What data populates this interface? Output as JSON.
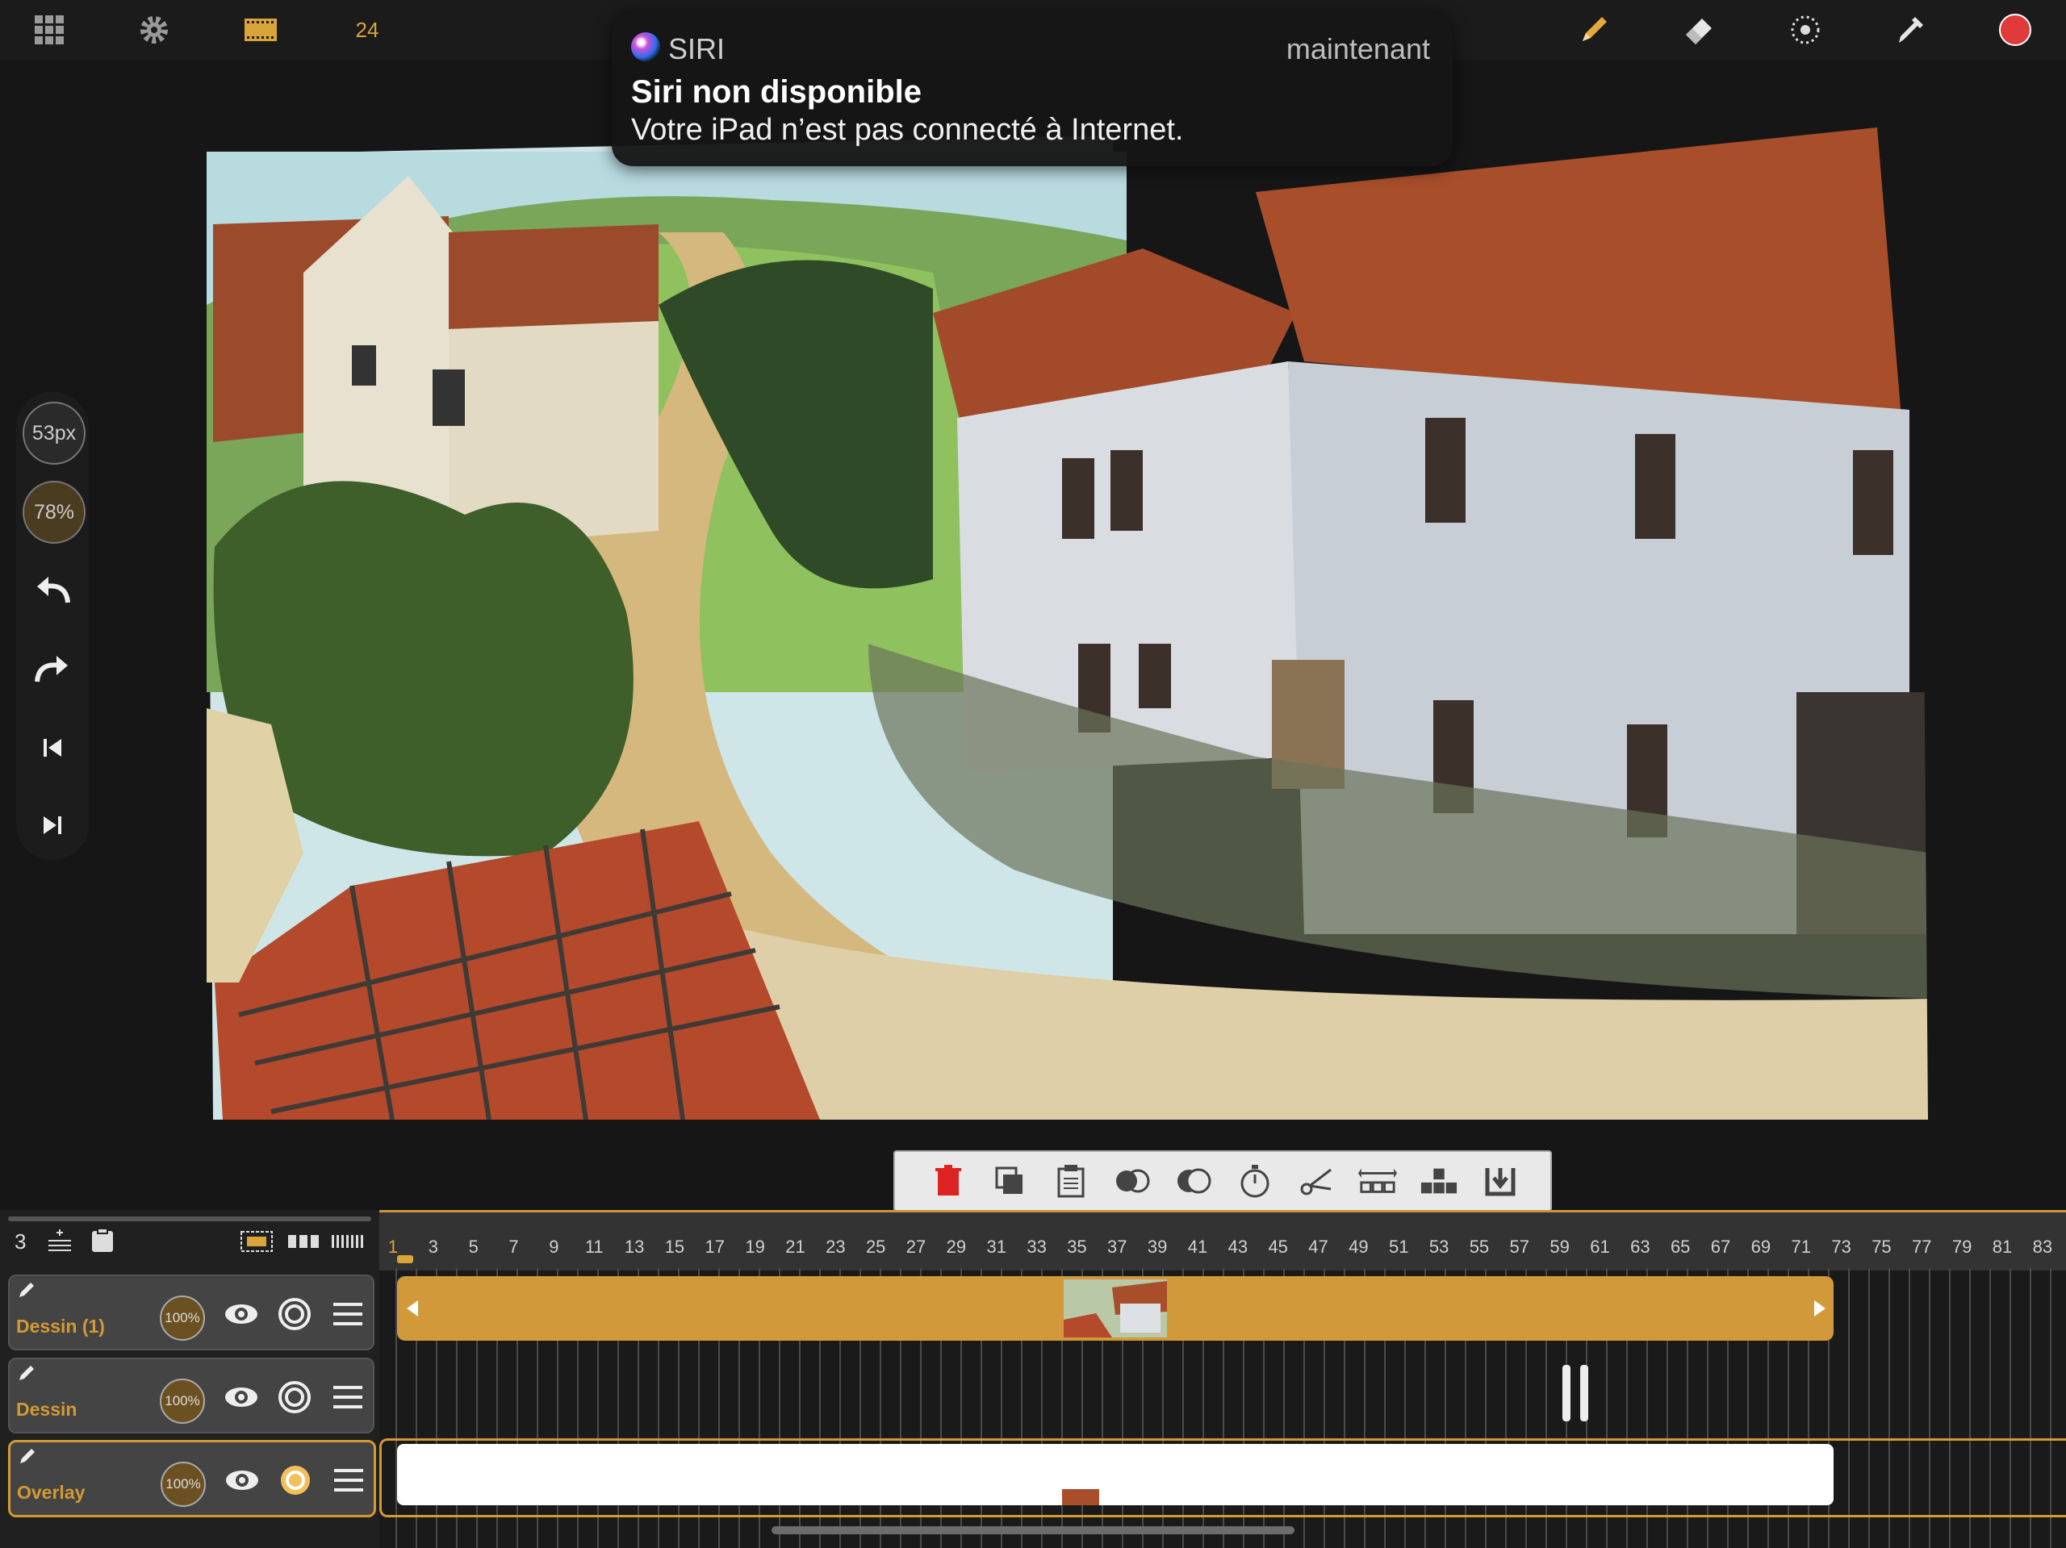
{
  "topbar": {
    "fps": "24",
    "left_icons": [
      "grid-icon",
      "gear-icon",
      "film-icon"
    ],
    "right_icons": [
      "pencil-icon",
      "eraser-icon",
      "smudge-icon",
      "eyedropper-icon",
      "color-swatch-icon"
    ],
    "record_color": "#e03a3a"
  },
  "notification": {
    "app": "SIRI",
    "time": "maintenant",
    "title": "Siri non disponible",
    "body": "Votre iPad n’est pas connecté à Internet."
  },
  "side_tools": {
    "brush_size": "53px",
    "opacity": "78%"
  },
  "timeline": {
    "layer_count": "3",
    "ruler_labels": [
      "1",
      "3",
      "5",
      "7",
      "9",
      "11",
      "13",
      "15",
      "17",
      "19",
      "21",
      "23",
      "25",
      "27",
      "29",
      "31",
      "33",
      "35",
      "37",
      "39",
      "41",
      "43",
      "45",
      "47",
      "49",
      "51",
      "53",
      "55",
      "57",
      "59",
      "61",
      "63",
      "65",
      "67",
      "69",
      "71",
      "73",
      "75",
      "77",
      "79",
      "81",
      "83"
    ],
    "layers": [
      {
        "name": "Dessin (1)",
        "opacity": "100%"
      },
      {
        "name": "Dessin",
        "opacity": "100%"
      },
      {
        "name": "Overlay",
        "opacity": "100%"
      }
    ],
    "accent": "#d39a33"
  }
}
